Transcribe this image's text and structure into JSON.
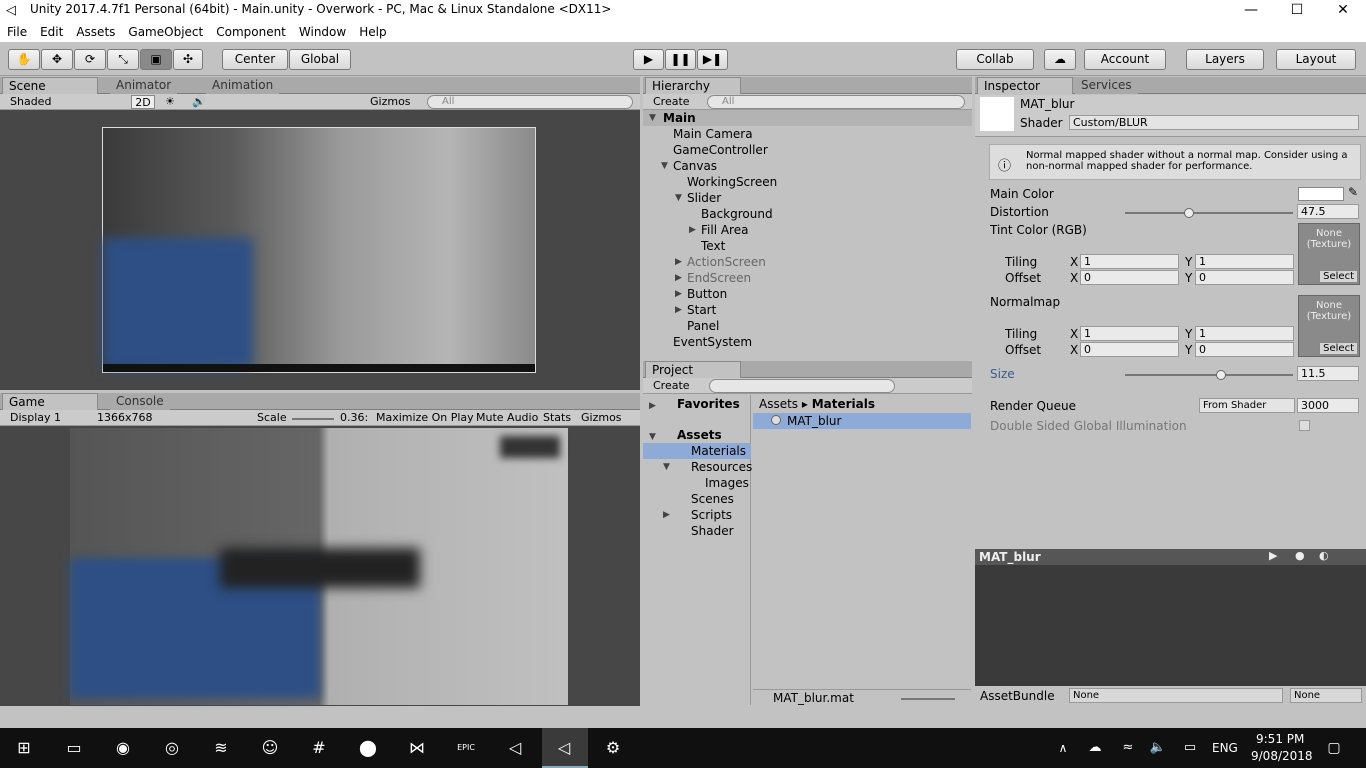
{
  "window": {
    "title": "Unity 2017.4.7f1 Personal (64bit) - Main.unity - Overwork - PC, Mac & Linux Standalone <DX11>",
    "minimize": "—",
    "maximize": "☐",
    "close": "✕"
  },
  "menu": [
    "File",
    "Edit",
    "Assets",
    "GameObject",
    "Component",
    "Window",
    "Help"
  ],
  "toolbar": {
    "tools": [
      "✋",
      "✥",
      "⟳",
      "⤡",
      "▣",
      "✣"
    ],
    "center": "Center",
    "global": "Global",
    "play": "▶",
    "pause": "❚❚",
    "step": "▶❚",
    "collab": "Collab",
    "cloud": "☁",
    "account": "Account",
    "layers": "Layers",
    "layout": "Layout"
  },
  "scene": {
    "tabs": [
      "Scene",
      "Animator",
      "Animation"
    ],
    "shaded": "Shaded",
    "mode2d": "2D",
    "gizmos": "Gizmos",
    "search_placeholder": "All"
  },
  "game": {
    "tabs": [
      "Game",
      "Console"
    ],
    "display": "Display 1",
    "resolution": "1366x768",
    "scale_label": "Scale",
    "scale_value": "0.36:",
    "maximize": "Maximize On Play",
    "mute": "Mute Audio",
    "stats": "Stats",
    "gizmos": "Gizmos"
  },
  "hierarchy": {
    "tab": "Hierarchy",
    "create": "Create",
    "search_placeholder": "All",
    "scene": "Main",
    "items": [
      "Main Camera",
      "GameController",
      "Canvas",
      "WorkingScreen",
      "Slider",
      "Background",
      "Fill Area",
      "Text",
      "ActionScreen",
      "EndScreen",
      "Button",
      "Start",
      "Panel",
      "EventSystem"
    ]
  },
  "project": {
    "tab": "Project",
    "create": "Create",
    "favorites": "Favorites",
    "assets": "Assets",
    "folders": [
      "Materials",
      "Resources",
      "Images",
      "Scenes",
      "Scripts",
      "Shader"
    ],
    "breadcrumb_root": "Assets",
    "breadcrumb_current": "Materials",
    "item": "MAT_blur",
    "footer_file": "MAT_blur.mat"
  },
  "inspector": {
    "tabs": [
      "Inspector",
      "Services"
    ],
    "material_name": "MAT_blur",
    "shader_label": "Shader",
    "shader_value": "Custom/BLUR",
    "warning": "Normal mapped shader without a normal map. Consider using a non-normal mapped shader for performance.",
    "main_color": "Main Color",
    "distortion": "Distortion",
    "distortion_value": "47.5",
    "distortion_fraction": 0.38,
    "tint": "Tint Color (RGB)",
    "tiling": "Tiling",
    "offset": "Offset",
    "x": "X",
    "y": "Y",
    "tint_tiling_x": "1",
    "tint_tiling_y": "1",
    "tint_offset_x": "0",
    "tint_offset_y": "0",
    "normalmap": "Normalmap",
    "normal_tiling_x": "1",
    "normal_tiling_y": "1",
    "normal_offset_x": "0",
    "normal_offset_y": "0",
    "tex_none": "None",
    "tex_type": "(Texture)",
    "tex_select": "Select",
    "size": "Size",
    "size_value": "11.5",
    "size_fraction": 0.57,
    "render_queue": "Render Queue",
    "render_queue_mode": "From Shader",
    "render_queue_value": "3000",
    "double_sided": "Double Sided Global Illumination",
    "preview_title": "MAT_blur",
    "assetbundle": "AssetBundle",
    "ab_none": "None",
    "ab_variant": "None"
  },
  "taskbar": {
    "lang": "ENG",
    "time": "9:51 PM",
    "date": "9/08/2018"
  },
  "colors": {
    "accent_blue": "#2d4f85",
    "selection": "#8eaad6"
  }
}
